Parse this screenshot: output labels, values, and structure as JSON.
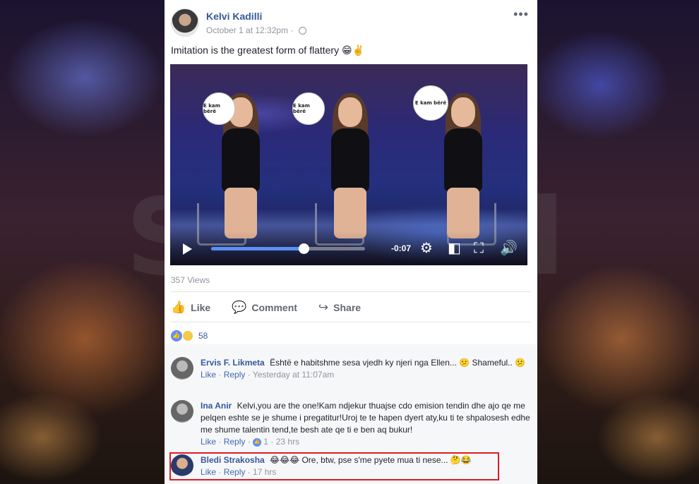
{
  "post": {
    "author": "Kelvi Kadilli",
    "timestamp": "October 1 at 12:32pm ·",
    "text": "Imitation is the greatest form of flattery",
    "text_emoji": "😁✌️",
    "more_label": "•••"
  },
  "video": {
    "paddle_text": "E kam bërë",
    "time_remaining": "-0:07",
    "progress": 0.6,
    "controls": {
      "settings_icon": "gear-icon",
      "pip_icon": "picture-in-picture-icon",
      "fullscreen_icon": "fullscreen-icon",
      "volume_icon": "volume-icon"
    }
  },
  "stats": {
    "views": "357 Views",
    "reaction_count": "58"
  },
  "actions": {
    "like": "Like",
    "comment": "Comment",
    "share": "Share"
  },
  "comments": [
    {
      "name": "Ervis F. Likmeta",
      "text": "Është e habitshme sesa vjedh ky njeri nga Ellen... 😕 Shameful.. 😕",
      "like": "Like",
      "reply": "Reply",
      "time": "Yesterday at 11:07am"
    },
    {
      "name": "Ina Anir",
      "text": "Kelvi,you are the one!Kam ndjekur thuajse cdo emision tendin dhe ajo qe me pelqen eshte se je shume i pregatitur!Uroj te te hapen dyert aty,ku ti te shpalosesh edhe me shume talentin tend,te besh ate qe ti e ben aq bukur!",
      "like": "Like",
      "reply": "Reply",
      "reactions": "1",
      "time": "23 hrs"
    },
    {
      "name": "Bledi Strakosha",
      "name_emoji": "😂😂😂",
      "text": "Ore, btw, pse s'me pyete mua ti nese... 🤔😂",
      "like": "Like",
      "reply": "Reply",
      "time": "17 hrs"
    }
  ],
  "watermark": "Story.al",
  "colors": {
    "link": "#365899",
    "accent": "#4267b2",
    "muted": "#90949c",
    "highlight": "#e01b24",
    "progress": "#5b8ff9"
  }
}
